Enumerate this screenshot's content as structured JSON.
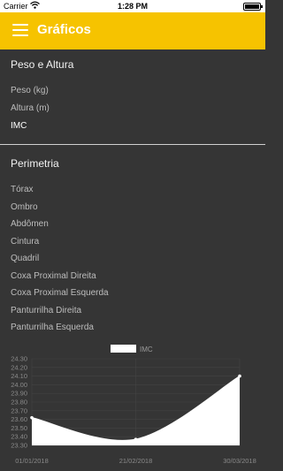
{
  "status_bar": {
    "carrier": "Carrier",
    "time": "1:28 PM"
  },
  "app_bar": {
    "title": "Gráficos",
    "menu_icon": "hamburger-menu-icon"
  },
  "sections": [
    {
      "title": "Peso e Altura",
      "items": [
        "Peso (kg)",
        "Altura (m)",
        "IMC"
      ],
      "active_item": "IMC"
    },
    {
      "title": "Perimetria",
      "items": [
        "Tórax",
        "Ombro",
        "Abdômen",
        "Cintura",
        "Quadril",
        "Coxa Proximal Direita",
        "Coxa Proximal Esquerda",
        "Panturrilha Direita",
        "Panturrilha Esquerda"
      ]
    }
  ],
  "colors": {
    "accent": "#f6c300",
    "background": "#353535",
    "chart_fill": "#ffffff"
  },
  "chart_data": {
    "type": "area",
    "legend": [
      "IMC"
    ],
    "legend_position": "top-center",
    "series": [
      {
        "name": "IMC",
        "points": [
          {
            "x": "01/01/2018",
            "y": 23.62
          },
          {
            "x": "21/02/2018",
            "y": 23.37
          },
          {
            "x": "30/03/2018",
            "y": 24.1
          }
        ]
      }
    ],
    "x_tick_labels": [
      "01/01/2018",
      "21/02/2018",
      "30/03/2018"
    ],
    "y_tick_labels": [
      "23.30",
      "23.40",
      "23.50",
      "23.60",
      "23.70",
      "23.80",
      "23.90",
      "24.00",
      "24.10",
      "24.20",
      "24.30"
    ],
    "ylim": [
      23.3,
      24.3
    ],
    "grid": true
  }
}
